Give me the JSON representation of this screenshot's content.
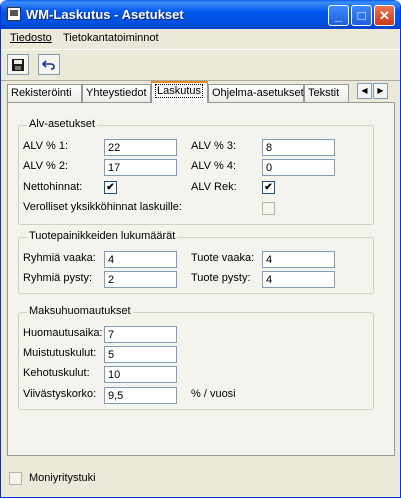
{
  "window": {
    "title": "WM-Laskutus - Asetukset",
    "controls": {
      "minimize": "_",
      "maximize": "□",
      "close": "✕"
    }
  },
  "menu": [
    "Tiedosto",
    "Tietokantatoiminnot"
  ],
  "toolbar": {
    "save_icon": "floppy-disk-icon",
    "undo_icon": "undo-icon"
  },
  "tabs": [
    "Rekisteröinti",
    "Yhteystiedot",
    "Laskutus",
    "Ohjelma-asetukset",
    "Tekstit"
  ],
  "active_tab": "Laskutus",
  "tab_nav": {
    "left": "◀",
    "right": "▶"
  },
  "alv": {
    "title": "Alv-asetukset",
    "alv1_label": "ALV % 1:",
    "alv1_value": "22",
    "alv2_label": "ALV % 2:",
    "alv2_value": "17",
    "alv3_label": "ALV % 3:",
    "alv3_value": "8",
    "alv4_label": "ALV % 4:",
    "alv4_value": "0",
    "nettohinnat_label": "Nettohinnat:",
    "nettohinnat_checked": true,
    "alvrek_label": "ALV Rek:",
    "alvrek_checked": true,
    "verolliset_label": "Verolliset yksikköhinnat laskuille:",
    "verolliset_checked": false,
    "check_mark": "✔"
  },
  "tuote": {
    "title": "Tuotepainikkeiden lukumäärät",
    "ryhmia_vaaka_label": "Ryhmiä vaaka:",
    "ryhmia_vaaka_value": "4",
    "ryhmia_pysty_label": "Ryhmiä pysty:",
    "ryhmia_pysty_value": "2",
    "tuote_vaaka_label": "Tuote vaaka:",
    "tuote_vaaka_value": "4",
    "tuote_pysty_label": "Tuote pysty:",
    "tuote_pysty_value": "4"
  },
  "maksu": {
    "title": "Maksuhuomautukset",
    "huomautusaika_label": "Huomautusaika:",
    "huomautusaika_value": "7",
    "muistutuskulut_label": "Muistutuskulut:",
    "muistutuskulut_value": "5",
    "kehotuskulut_label": "Kehotuskulut:",
    "kehotuskulut_value": "10",
    "viivastyskorko_label": "Viivästyskorko:",
    "viivastyskorko_value": "9,5",
    "unit": "% / vuosi"
  },
  "footer": {
    "moniyritystuki_label": "Moniyritystuki",
    "moniyritystuki_checked": false
  }
}
